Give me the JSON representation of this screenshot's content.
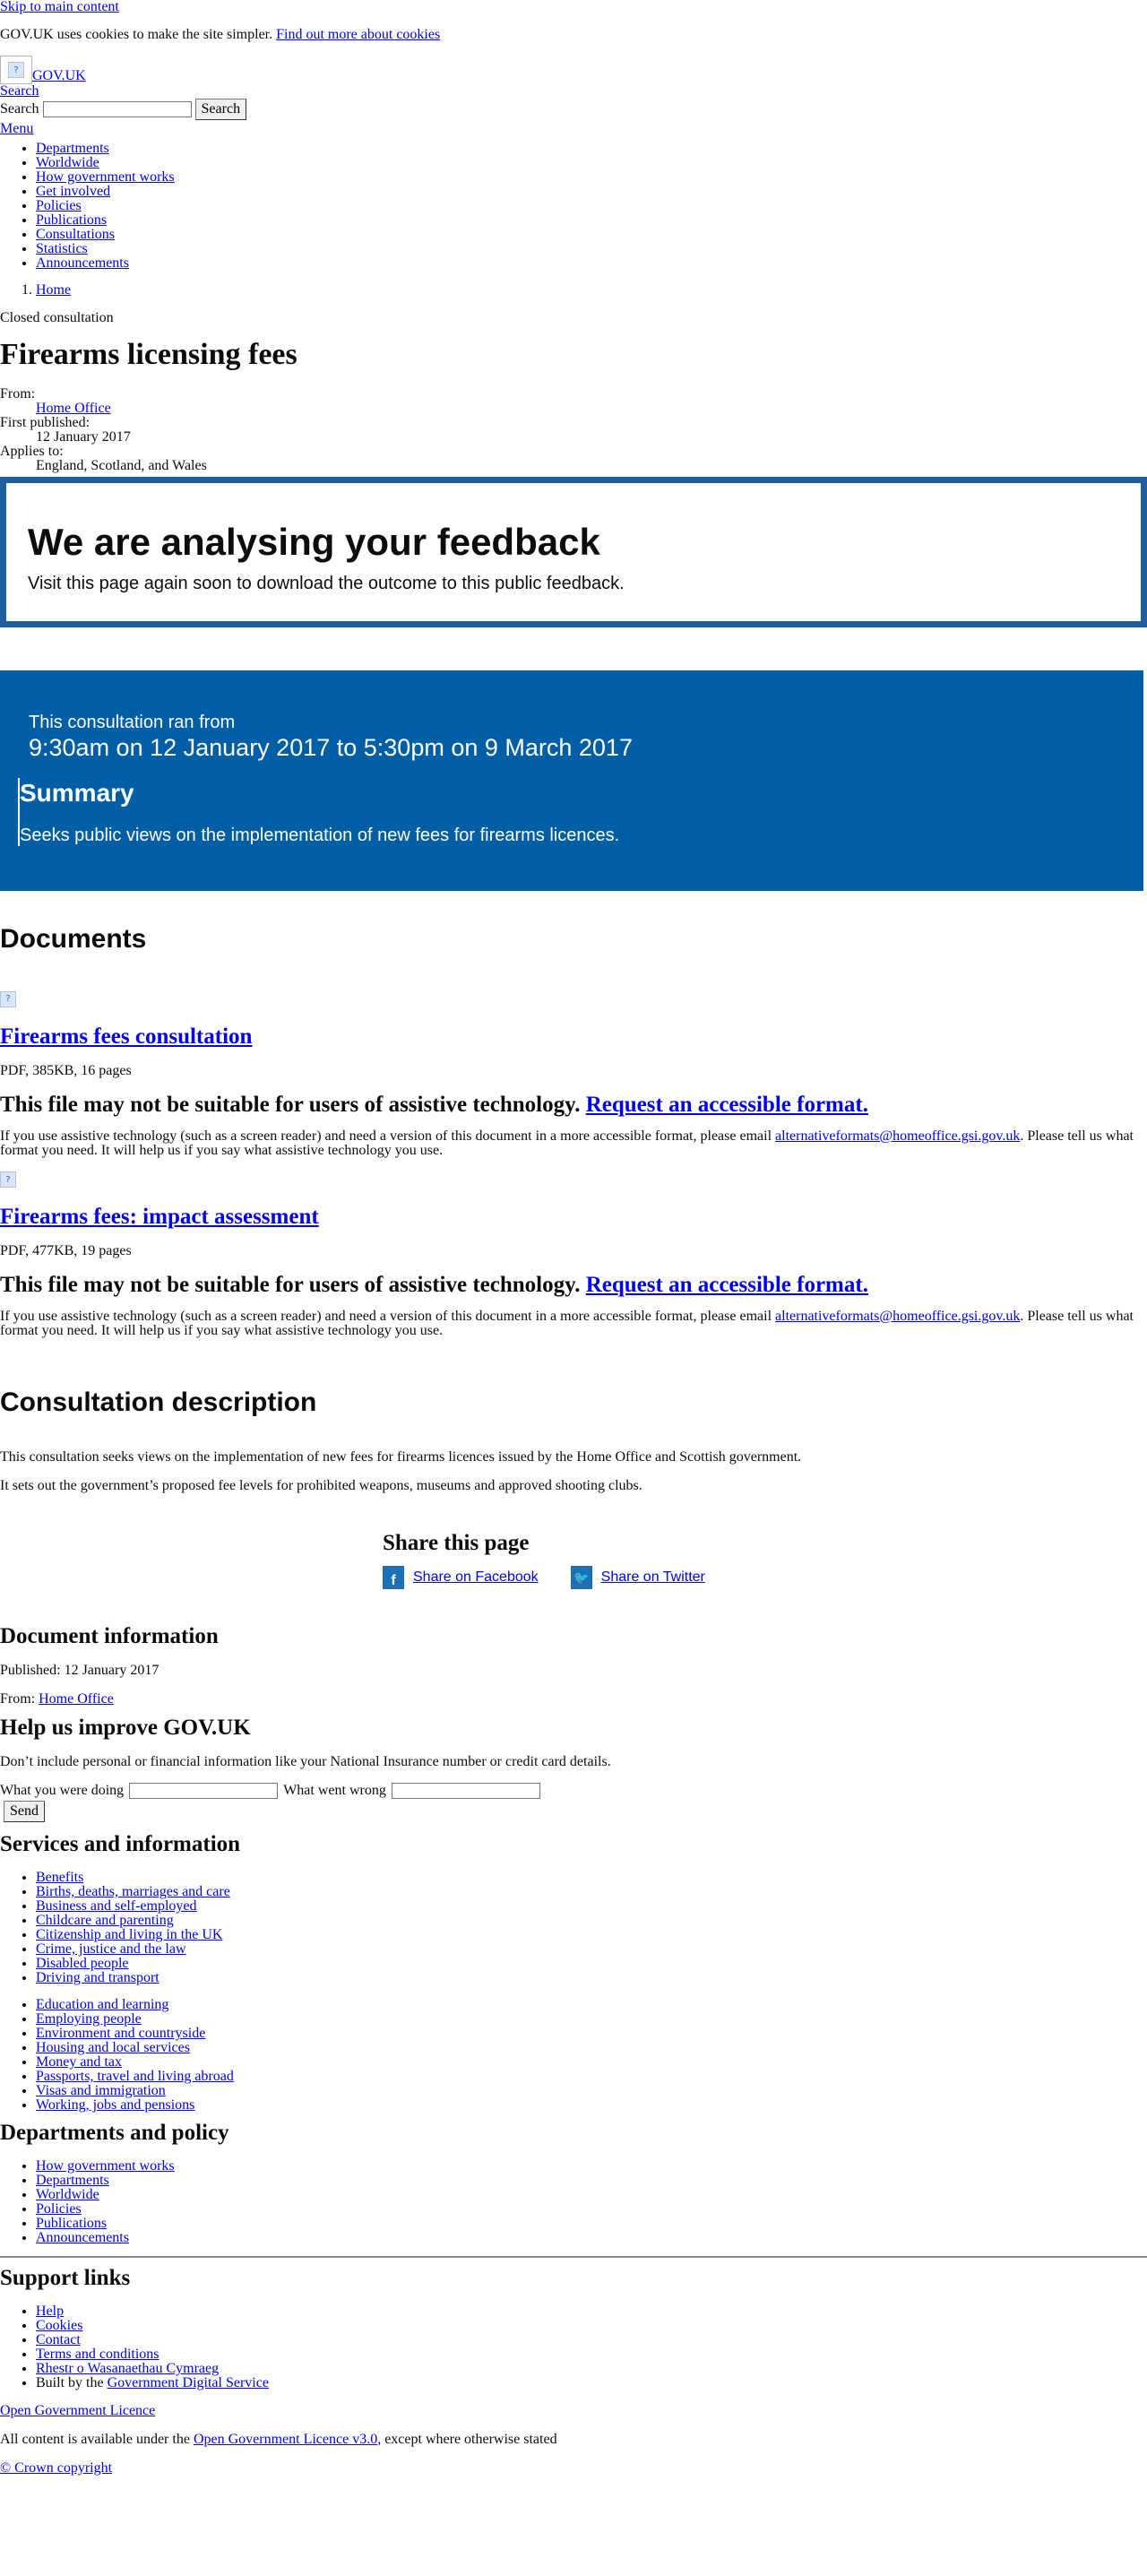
{
  "skip_link": "Skip to main content",
  "cookie": {
    "text": "GOV.UK uses cookies to make the site simpler.",
    "link": "Find out more about cookies"
  },
  "header": {
    "logo_text": "GOV.UK",
    "search_toggle": "Search",
    "search_label": "Search",
    "search_button": "Search",
    "menu": "Menu"
  },
  "nav": [
    "Departments",
    "Worldwide",
    "How government works",
    "Get involved",
    "Policies",
    "Publications",
    "Consultations",
    "Statistics",
    "Announcements"
  ],
  "breadcrumbs": [
    "Home"
  ],
  "page": {
    "status": "Closed consultation",
    "title": "Firearms licensing fees",
    "meta": {
      "from_label": "From:",
      "from_value": "Home Office",
      "published_label": "First published:",
      "published_value": "12 January 2017",
      "applies_label": "Applies to:",
      "applies_value": "England, Scotland, and Wales"
    }
  },
  "analysing": {
    "heading": "We are analysing your feedback",
    "text": "Visit this page again soon to download the outcome to this public feedback."
  },
  "consultation": {
    "ran_label": "This consultation ran from",
    "ran_range": "9:30am on 12 January 2017 to 5:30pm on 9 March 2017",
    "summary_heading": "Summary",
    "summary_text": "Seeks public views on the implementation of new fees for firearms licences."
  },
  "documents": {
    "heading": "Documents",
    "items": [
      {
        "title": "Firearms fees consultation",
        "meta": "PDF, 385KB, 16 pages",
        "warning": "This file may not be suitable for users of assistive technology.",
        "request": "Request an accessible format.",
        "note_before": "If you use assistive technology (such as a screen reader) and need a version of this document in a more accessible format, please email",
        "email": "alternativeformats@homeoffice.gsi.gov.uk",
        "note_after": ". Please tell us what format you need. It will help us if you say what assistive technology you use."
      },
      {
        "title": "Firearms fees: impact assessment",
        "meta": "PDF, 477KB, 19 pages",
        "warning": "This file may not be suitable for users of assistive technology.",
        "request": "Request an accessible format.",
        "note_before": "If you use assistive technology (such as a screen reader) and need a version of this document in a more accessible format, please email",
        "email": "alternativeformats@homeoffice.gsi.gov.uk",
        "note_after": ". Please tell us what format you need. It will help us if you say what assistive technology you use."
      }
    ]
  },
  "description": {
    "heading": "Consultation description",
    "p1": "This consultation seeks views on the implementation of new fees for firearms licences issued by the Home Office and Scottish government.",
    "p2": "It sets out the government’s proposed fee levels for prohibited weapons, museums and approved shooting clubs."
  },
  "share": {
    "heading": "Share this page",
    "facebook": "Share on Facebook",
    "twitter": "Share on Twitter"
  },
  "doc_info": {
    "heading": "Document information",
    "published": "Published: 12 January 2017",
    "from_label": "From:",
    "from_link": "Home Office"
  },
  "improve": {
    "heading": "Help us improve GOV.UK",
    "text": "Don’t include personal or financial information like your National Insurance number or credit card details.",
    "doing_label": "What you were doing",
    "wrong_label": "What went wrong",
    "send": "Send"
  },
  "services": {
    "heading": "Services and information",
    "col1": [
      "Benefits",
      "Births, deaths, marriages and care",
      "Business and self-employed",
      "Childcare and parenting",
      "Citizenship and living in the UK",
      "Crime, justice and the law",
      "Disabled people",
      "Driving and transport"
    ],
    "col2": [
      "Education and learning",
      "Employing people",
      "Environment and countryside",
      "Housing and local services",
      "Money and tax",
      "Passports, travel and living abroad",
      "Visas and immigration",
      "Working, jobs and pensions"
    ]
  },
  "departments": {
    "heading": "Departments and policy",
    "items": [
      "How government works",
      "Departments",
      "Worldwide",
      "Policies",
      "Publications",
      "Announcements"
    ]
  },
  "support": {
    "heading": "Support links",
    "items": [
      "Help",
      "Cookies",
      "Contact",
      "Terms and conditions",
      "Rhestr o Wasanaethau Cymraeg"
    ],
    "built_by": "Built by the",
    "built_link": "Government Digital Service"
  },
  "footer": {
    "ogl": "Open Government Licence",
    "licence_before": "All content is available under the",
    "licence_link": "Open Government Licence v3.0",
    "licence_after": ", except where otherwise stated",
    "copyright": "© Crown copyright"
  }
}
